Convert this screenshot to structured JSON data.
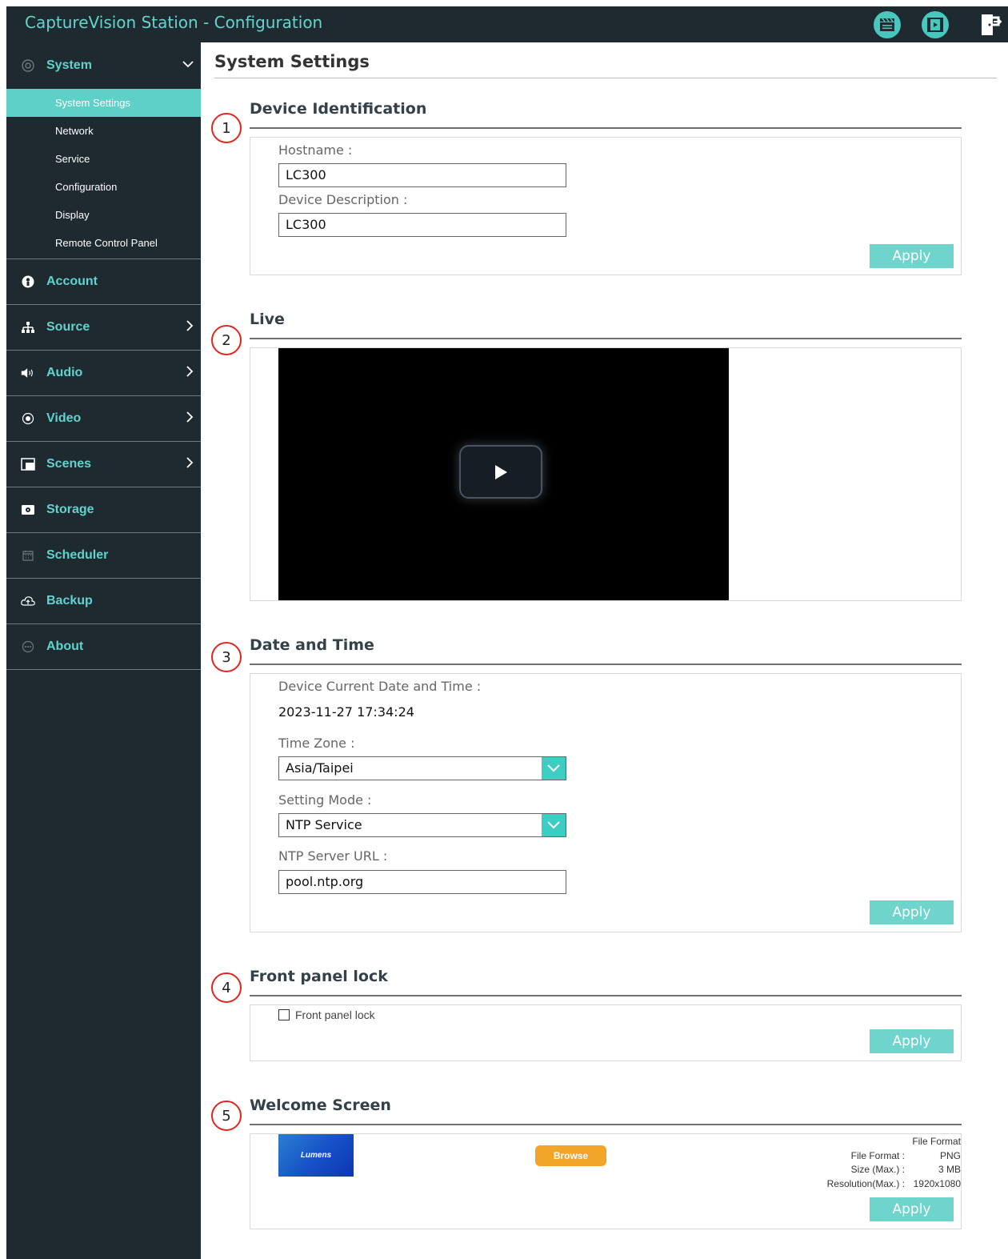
{
  "header": {
    "title": "CaptureVision Station - Configuration",
    "icons": [
      "clapperboard-icon",
      "film-icon",
      "exit-icon"
    ]
  },
  "sidebar": {
    "groups": [
      {
        "label": "System",
        "icon": "gear-circle-icon",
        "chevron": "down"
      },
      {
        "label": "Account",
        "icon": "user-circle-icon"
      },
      {
        "label": "Source",
        "icon": "network-tree-icon",
        "chevron": "right"
      },
      {
        "label": "Audio",
        "icon": "speaker-icon",
        "chevron": "right"
      },
      {
        "label": "Video",
        "icon": "record-icon",
        "chevron": "right"
      },
      {
        "label": "Scenes",
        "icon": "layout-icon",
        "chevron": "right"
      },
      {
        "label": "Storage",
        "icon": "storage-icon"
      },
      {
        "label": "Scheduler",
        "icon": "calendar-icon"
      },
      {
        "label": "Backup",
        "icon": "cloud-upload-icon"
      },
      {
        "label": "About",
        "icon": "chat-dots-icon"
      }
    ],
    "system_items": [
      "System Settings",
      "Network",
      "Service",
      "Configuration",
      "Display",
      "Remote Control Panel"
    ]
  },
  "page": {
    "title": "System Settings"
  },
  "sections": {
    "device_identification": {
      "number": "1",
      "title": "Device Identification",
      "hostname_label": "Hostname :",
      "hostname_value": "LC300",
      "description_label": "Device Description :",
      "description_value": "LC300",
      "apply": "Apply"
    },
    "live": {
      "number": "2",
      "title": "Live"
    },
    "date_time": {
      "number": "3",
      "title": "Date and Time",
      "current_label": "Device Current Date and Time :",
      "current_value": "2023-11-27 17:34:24",
      "timezone_label": "Time Zone :",
      "timezone_value": "Asia/Taipei",
      "mode_label": "Setting Mode :",
      "mode_value": "NTP Service",
      "ntp_label": "NTP Server URL :",
      "ntp_value": "pool.ntp.org",
      "apply": "Apply"
    },
    "front_panel": {
      "number": "4",
      "title": "Front panel lock",
      "checkbox_label": "Front panel lock",
      "checked": false,
      "apply": "Apply"
    },
    "welcome": {
      "number": "5",
      "title": "Welcome Screen",
      "thumbnail_text": "Lumens",
      "browse": "Browse",
      "file_format_heading": "File Format",
      "file_format_label": "File Format :",
      "file_format_value": "PNG",
      "size_label": "Size (Max.) :",
      "size_value": "3 MB",
      "resolution_label": "Resolution(Max.) :",
      "resolution_value": "1920x1080",
      "apply": "Apply"
    }
  },
  "colors": {
    "dark_bg": "#1e2a30",
    "accent": "#5fd0c8",
    "browse": "#f3a52a",
    "badge_ring": "#e0261f"
  }
}
